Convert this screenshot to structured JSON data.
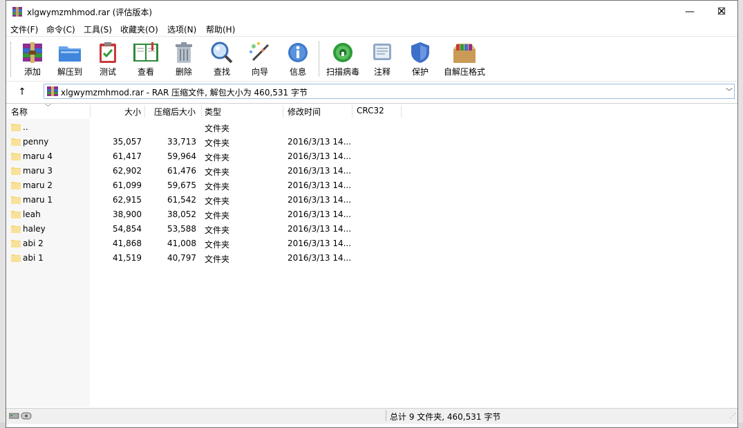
{
  "window": {
    "title": "xlgwymzmhmod.rar (评估版本)",
    "controls": {
      "minimize": "—",
      "maximize": "☐",
      "close": "✕"
    }
  },
  "menu": [
    "文件(F)",
    "命令(C)",
    "工具(S)",
    "收藏夹(O)",
    "选项(N)",
    "帮助(H)"
  ],
  "toolbar": [
    {
      "label": "添加",
      "icon": "add-archive-icon"
    },
    {
      "label": "解压到",
      "icon": "extract-folder-icon"
    },
    {
      "label": "测试",
      "icon": "test-clipboard-icon"
    },
    {
      "label": "查看",
      "icon": "view-book-icon"
    },
    {
      "label": "删除",
      "icon": "trash-icon"
    },
    {
      "label": "查找",
      "icon": "magnifier-icon"
    },
    {
      "label": "向导",
      "icon": "wizard-wand-icon"
    },
    {
      "label": "信息",
      "icon": "info-icon"
    },
    {
      "label": "扫描病毒",
      "icon": "virus-scan-icon"
    },
    {
      "label": "注释",
      "icon": "comment-icon"
    },
    {
      "label": "保护",
      "icon": "shield-icon"
    },
    {
      "label": "自解压格式",
      "icon": "sfx-box-icon"
    }
  ],
  "address": {
    "path": "xlgwymzmhmod.rar - RAR 压缩文件, 解包大小为 460,531 字节"
  },
  "columns": {
    "name": "名称",
    "size": "大小",
    "packed": "压缩后大小",
    "type": "类型",
    "modified": "修改时间",
    "crc": "CRC32"
  },
  "rows": [
    {
      "name": "..",
      "size": "",
      "packed": "",
      "type": "文件夹",
      "modified": ""
    },
    {
      "name": "penny",
      "size": "35,057",
      "packed": "33,713",
      "type": "文件夹",
      "modified": "2016/3/13 14..."
    },
    {
      "name": "maru 4",
      "size": "61,417",
      "packed": "59,964",
      "type": "文件夹",
      "modified": "2016/3/13 14..."
    },
    {
      "name": "maru 3",
      "size": "62,902",
      "packed": "61,476",
      "type": "文件夹",
      "modified": "2016/3/13 14..."
    },
    {
      "name": "maru 2",
      "size": "61,099",
      "packed": "59,675",
      "type": "文件夹",
      "modified": "2016/3/13 14..."
    },
    {
      "name": "maru 1",
      "size": "62,915",
      "packed": "61,542",
      "type": "文件夹",
      "modified": "2016/3/13 14..."
    },
    {
      "name": "leah",
      "size": "38,900",
      "packed": "38,052",
      "type": "文件夹",
      "modified": "2016/3/13 14..."
    },
    {
      "name": "haley",
      "size": "54,854",
      "packed": "53,588",
      "type": "文件夹",
      "modified": "2016/3/13 14..."
    },
    {
      "name": "abi 2",
      "size": "41,868",
      "packed": "41,008",
      "type": "文件夹",
      "modified": "2016/3/13 14..."
    },
    {
      "name": "abi 1",
      "size": "41,519",
      "packed": "40,797",
      "type": "文件夹",
      "modified": "2016/3/13 14..."
    }
  ],
  "status": {
    "summary": "总计 9 文件夹, 460,531 字节"
  },
  "colors": {
    "folder": "#f5d77a",
    "address_border": "#9bbbe0"
  }
}
